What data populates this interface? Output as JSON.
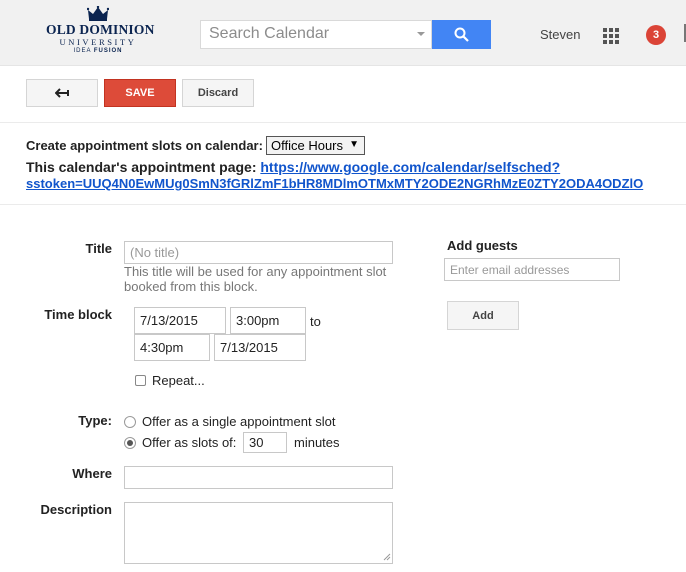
{
  "header": {
    "logo": {
      "line1": "OLD DOMINION",
      "line2": "UNIVERSITY",
      "line3a": "IDEA",
      "line3b": "FUSION"
    },
    "search": {
      "placeholder": "Search Calendar"
    },
    "user": "Steven",
    "notifications": "3"
  },
  "toolbar": {
    "save_label": "SAVE",
    "discard_label": "Discard"
  },
  "calendar": {
    "label": "Create appointment slots on calendar:",
    "selected": "Office Hours",
    "page_label": "This calendar's appointment page:",
    "link_line1": "https://www.google.com/calendar/selfsched?",
    "link_line2": "sstoken=UUQ4N0EwMUg0SmN3fGRlZmF1bHR8MDlmOTMxMTY2ODE2NGRhMzE0ZTY2ODA4ODZlO"
  },
  "form": {
    "title_label": "Title",
    "title_placeholder": "(No title)",
    "title_hint": "This title will be used for any appointment slot booked from this block.",
    "time_label": "Time block",
    "start_date": "7/13/2015",
    "start_time": "3:00pm",
    "to_label": "to",
    "end_time": "4:30pm",
    "end_date": "7/13/2015",
    "repeat_label": "Repeat...",
    "type_label": "Type:",
    "option_single": "Offer as a single appointment slot",
    "option_slots": "Offer as slots of:",
    "slot_minutes": "30",
    "minutes_label": "minutes",
    "where_label": "Where",
    "description_label": "Description"
  },
  "guests": {
    "label": "Add guests",
    "placeholder": "Enter email addresses",
    "add_label": "Add"
  },
  "colors": {
    "save": "#dd4b39",
    "search_button": "#4285f4",
    "link": "#1155cc",
    "badge": "#db4437"
  }
}
